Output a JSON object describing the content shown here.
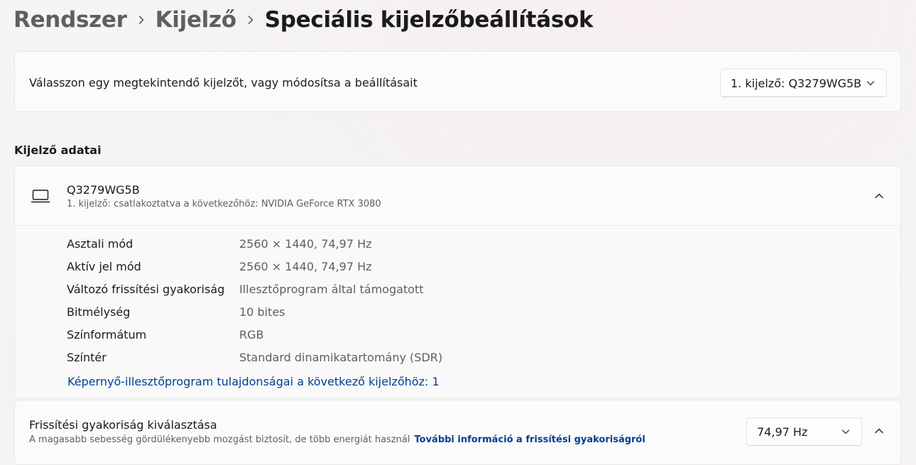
{
  "breadcrumb": {
    "items": [
      "Rendszer",
      "Kijelző"
    ],
    "current": "Speciális kijelzőbeállítások"
  },
  "display_select": {
    "prompt": "Válasszon egy megtekintendő kijelzőt, vagy módosítsa a beállításait",
    "selected": "1. kijelző: Q3279WG5B"
  },
  "display_info": {
    "section_title": "Kijelző adatai",
    "device_name": "Q3279WG5B",
    "device_subtitle": "1. kijelző: csatlakoztatva a következőhöz: NVIDIA GeForce RTX 3080",
    "rows": [
      {
        "label": "Asztali mód",
        "value": "2560 × 1440, 74,97 Hz"
      },
      {
        "label": "Aktív jel mód",
        "value": "2560 × 1440, 74,97 Hz"
      },
      {
        "label": "Változó frissítési gyakoriság",
        "value": "Illesztőprogram által támogatott"
      },
      {
        "label": "Bitmélység",
        "value": "10 bites"
      },
      {
        "label": "Színformátum",
        "value": "RGB"
      },
      {
        "label": "Színtér",
        "value": "Standard dinamikatartomány (SDR)"
      }
    ],
    "adapter_link": "Képernyő-illesztőprogram tulajdonságai a következő kijelzőhöz: 1",
    "icons": {
      "device": "monitor-icon",
      "toggle": "chevron-up-icon"
    }
  },
  "refresh_rate": {
    "title": "Frissítési gyakoriság kiválasztása",
    "description": "A magasabb sebesség gördülékenyebb mozgást biztosít, de több energiát használ",
    "link": "További információ a frissítési gyakoriságról",
    "selected": "74,97 Hz"
  },
  "colors": {
    "accent_link": "#003e92",
    "text_primary": "#1b1b1b",
    "text_secondary": "#5f5f5f",
    "card_background": "#fbfbfb"
  }
}
